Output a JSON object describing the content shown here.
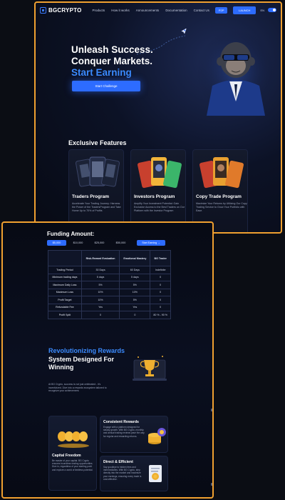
{
  "nav": {
    "logo": "BGCRYPTO",
    "links": [
      "Products",
      "How it works",
      "Announcements",
      "Documentation",
      "Contact Us"
    ],
    "ref_button": "P2P",
    "launch_button": "LAUNCH",
    "lang": "EN"
  },
  "hero": {
    "line1": "Unleash Success.",
    "line2": "Conquer Markets.",
    "line3": "Start Earning",
    "cta": "Start Challenge"
  },
  "features": {
    "title": "Exclusive Features",
    "cards": [
      {
        "name": "Traders Program",
        "desc": "Accelerate Your Trading Journey: Harness the Power of the TradersProgram and Take Home Up to 70% of Profits"
      },
      {
        "name": "Investors Program",
        "desc": "Amplify Your Investment Potential: Gain Exclusive Access to the Best Traders on Our Platform with the Investor Program"
      },
      {
        "name": "Copy Trade Program",
        "desc": "Maximize Your Returns by Utilizing Our Copy Trading Service to Grow Your Portfolio with Ease."
      }
    ]
  },
  "funding": {
    "title": "Funding Amount:",
    "tabs": [
      "$5,000",
      "$10,000",
      "$25,000",
      "$50,000"
    ],
    "active_tab": 0,
    "start_button": "Start Earning →",
    "headers": [
      "",
      "Risk-Reward Evaluation",
      "Emotional Mastery",
      "BG Trader"
    ],
    "rows": [
      [
        "Trading Period",
        "30 Days",
        "60 Days",
        "Indefinite"
      ],
      [
        "Minimum trading days",
        "5 days",
        "5 days",
        "0"
      ],
      [
        "Maximum Daily Loss",
        "5%",
        "5%",
        "0"
      ],
      [
        "Maximum Loss",
        "10%",
        "10%",
        "0"
      ],
      [
        "Profit Target",
        "10%",
        "5%",
        "0"
      ],
      [
        "Refundable Fee",
        "Yes",
        "Yes",
        "0"
      ],
      [
        "Profit Split",
        "0",
        "0",
        "80 % - 90 %"
      ]
    ]
  },
  "rewards": {
    "title_accent": "Revolutionizing Rewards",
    "title_rest": "System Designed For Winning",
    "desc": "At BG Crypto, success is not just celebrated - it's incentivized. Dive into a rewards ecosystem tailored to recognize your achievement.",
    "cards": [
      {
        "title": "Consistent Rewards",
        "desc": "Engage with a platform designed for steady growth. With BG Crypto, monthly and annual trading reviews pave the way for regular and rewarding returns."
      },
      {
        "title": "Capital Freedom",
        "desc": "Be master of your capital. BG Crypto ensures boundless trading opportunities. Dive in, regardless of your starting point and explore a world of limitless potential."
      },
      {
        "title": "Direct & Efficient",
        "desc": "Say goodbye to hidden fees and intermediaries. With BG Crypto, step directly into the market and maximize your earnings, ensuring every trade is cost-effective."
      }
    ]
  },
  "colors": {
    "accent": "#2d6cff",
    "highlight_border": "#f0a030",
    "background": "#0b0d14"
  }
}
